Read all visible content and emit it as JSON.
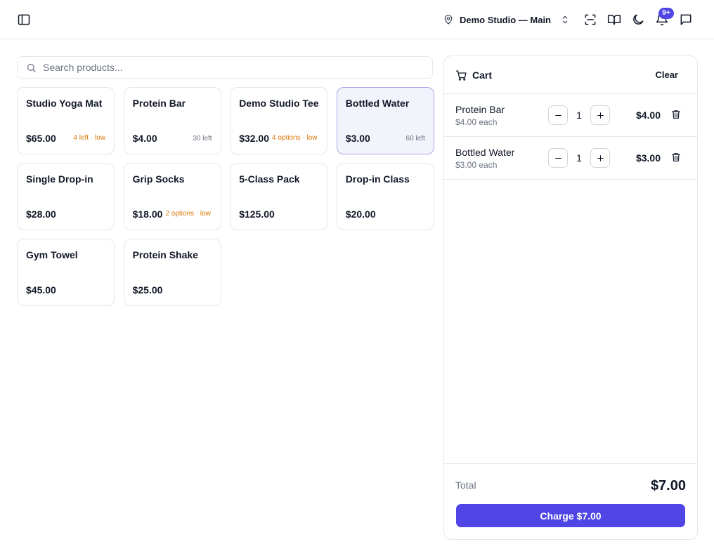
{
  "header": {
    "studio_name": "Demo Studio — Main",
    "notification_count": "9+",
    "icons": [
      "sidebar-toggle-icon",
      "map-pin-icon",
      "chevron-up-down-icon",
      "scan-icon",
      "book-icon",
      "moon-icon",
      "bell-icon",
      "message-icon"
    ]
  },
  "search": {
    "placeholder": "Search products..."
  },
  "products": [
    {
      "name": "Studio Yoga Mat",
      "price": "$65.00",
      "stock": "4 left · low",
      "low": true
    },
    {
      "name": "Protein Bar",
      "price": "$4.00",
      "stock": "30 left",
      "low": false
    },
    {
      "name": "Demo Studio Tee",
      "price": "$32.00",
      "stock": "4 options · low",
      "low": true
    },
    {
      "name": "Bottled Water",
      "price": "$3.00",
      "stock": "60 left",
      "low": false,
      "selected": true
    },
    {
      "name": "Single Drop-in",
      "price": "$28.00",
      "stock": "",
      "low": false
    },
    {
      "name": "Grip Socks",
      "price": "$18.00",
      "stock": "2 options · low",
      "low": true
    },
    {
      "name": "5-Class Pack",
      "price": "$125.00",
      "stock": "",
      "low": false
    },
    {
      "name": "Drop-in Class",
      "price": "$20.00",
      "stock": "",
      "low": false
    },
    {
      "name": "Gym Towel",
      "price": "$45.00",
      "stock": "",
      "low": false
    },
    {
      "name": "Protein Shake",
      "price": "$25.00",
      "stock": "",
      "low": false
    }
  ],
  "cart": {
    "title": "Cart",
    "clear_label": "Clear",
    "items": [
      {
        "name": "Protein Bar",
        "each": "$4.00 each",
        "qty": "1",
        "total": "$4.00"
      },
      {
        "name": "Bottled Water",
        "each": "$3.00 each",
        "qty": "1",
        "total": "$3.00"
      }
    ],
    "total_label": "Total",
    "total_value": "$7.00",
    "charge_label": "Charge $7.00"
  },
  "colors": {
    "accent": "#4f46e5",
    "low_stock": "#d97706",
    "border": "#e5e7eb"
  }
}
